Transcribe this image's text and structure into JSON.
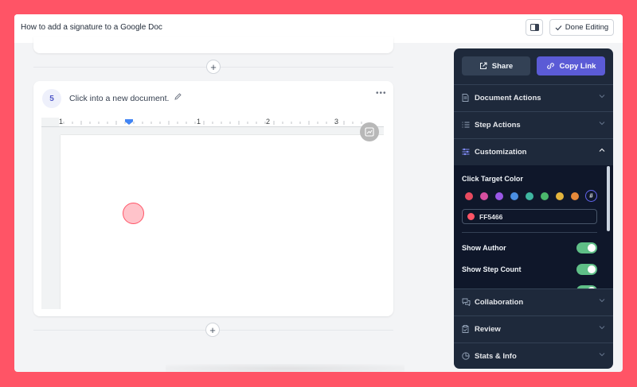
{
  "header": {
    "title": "How to add a signature to a Google Doc",
    "done_label": "Done Editing"
  },
  "step": {
    "number": "5",
    "text": "Click into a new document."
  },
  "ruler": {
    "numbers": [
      "1",
      "1",
      "2",
      "3"
    ]
  },
  "sidebar": {
    "share_label": "Share",
    "copy_link_label": "Copy Link",
    "sections": {
      "document_actions": "Document Actions",
      "step_actions": "Step Actions",
      "customization": "Customization",
      "collaboration": "Collaboration",
      "review": "Review",
      "stats": "Stats & Info"
    },
    "customization": {
      "click_target_label": "Click Target Color",
      "swatches": [
        "#e84a5f",
        "#d64fa0",
        "#9a57e6",
        "#4b8fe2",
        "#3fb6a0",
        "#4bb86c",
        "#e3b43d",
        "#e6893a"
      ],
      "hex_value": "FF5466",
      "hex_color": "#FF5466",
      "show_author": "Show Author",
      "show_step_count": "Show Step Count"
    }
  },
  "colors": {
    "background": "#FF5466",
    "accent": "#5b5bd6",
    "toggle_on": "#5fbf87"
  }
}
